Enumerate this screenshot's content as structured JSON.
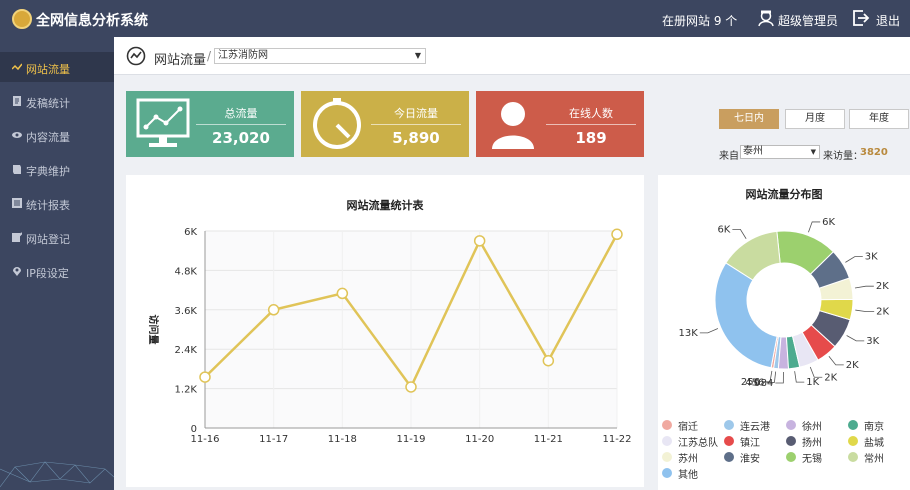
{
  "app": {
    "title": "全网信息分析系统",
    "site_count": "在册网站 9 个",
    "admin": "超级管理员",
    "exit": "退出"
  },
  "sidebar": {
    "items": [
      {
        "label": "网站流量",
        "icon": "chart-line-icon"
      },
      {
        "label": "发稿统计",
        "icon": "document-icon"
      },
      {
        "label": "内容流量",
        "icon": "eye-icon"
      },
      {
        "label": "字典维护",
        "icon": "book-icon"
      },
      {
        "label": "统计报表",
        "icon": "report-icon"
      },
      {
        "label": "网站登记",
        "icon": "register-icon"
      },
      {
        "label": "IP段设定",
        "icon": "location-pin-icon"
      }
    ]
  },
  "header": {
    "title": "网站流量",
    "site_select": "江苏消防网"
  },
  "cards": [
    {
      "title": "总流量",
      "value": "23,020",
      "color": "#5bab8f",
      "icon": "monitor-chart-icon"
    },
    {
      "title": "今日流量",
      "value": "5,890",
      "color": "#cbb048",
      "icon": "stopwatch-icon"
    },
    {
      "title": "在线人数",
      "value": "189",
      "color": "#cd5c4a",
      "icon": "user-icon"
    }
  ],
  "ranges": [
    "七日内",
    "月度",
    "年度"
  ],
  "source": {
    "label": "来自",
    "value": "泰州",
    "count_label": "来访量：",
    "count": "3820"
  },
  "chart_data": [
    {
      "type": "line",
      "title": "网站流量统计表",
      "ylabel": "访问量",
      "categories": [
        "11-16",
        "11-17",
        "11-18",
        "11-19",
        "11-20",
        "11-21",
        "11-22"
      ],
      "values": [
        1550,
        3600,
        4100,
        1250,
        5700,
        2050,
        5900
      ],
      "ylim": [
        0,
        6000
      ],
      "yticks": [
        "0",
        "1.2K",
        "2.4K",
        "3.6K",
        "4.8K",
        "6K"
      ],
      "color": "#e0c458",
      "grid": true
    },
    {
      "type": "pie",
      "title": "网站流量分布图",
      "slices": [
        {
          "name": "宿迁",
          "value": 256,
          "label": "256",
          "color": "#f0a9a0"
        },
        {
          "name": "连云港",
          "value": 456,
          "label": "456",
          "color": "#9ec8ea"
        },
        {
          "name": "徐州",
          "value": 984,
          "label": "984",
          "color": "#c7b3df"
        },
        {
          "name": "南京",
          "value": 1100,
          "label": "1K",
          "color": "#4dab8f"
        },
        {
          "name": "江苏总队",
          "value": 1900,
          "label": "2K",
          "color": "#e8e6f4"
        },
        {
          "name": "镇江",
          "value": 2100,
          "label": "2K",
          "color": "#e64b4b"
        },
        {
          "name": "扬州",
          "value": 3000,
          "label": "3K",
          "color": "#585c72"
        },
        {
          "name": "盐城",
          "value": 2000,
          "label": "2K",
          "color": "#e0d84a"
        },
        {
          "name": "苏州",
          "value": 2100,
          "label": "2K",
          "color": "#f3f2d5"
        },
        {
          "name": "淮安",
          "value": 3000,
          "label": "3K",
          "color": "#5e6f89"
        },
        {
          "name": "无锡",
          "value": 6000,
          "label": "6K",
          "color": "#9cd06e"
        },
        {
          "name": "常州",
          "value": 6000,
          "label": "6K",
          "color": "#c9dca0"
        },
        {
          "name": "其他",
          "value": 13000,
          "label": "13K",
          "color": "#8fc2ee"
        }
      ]
    }
  ]
}
